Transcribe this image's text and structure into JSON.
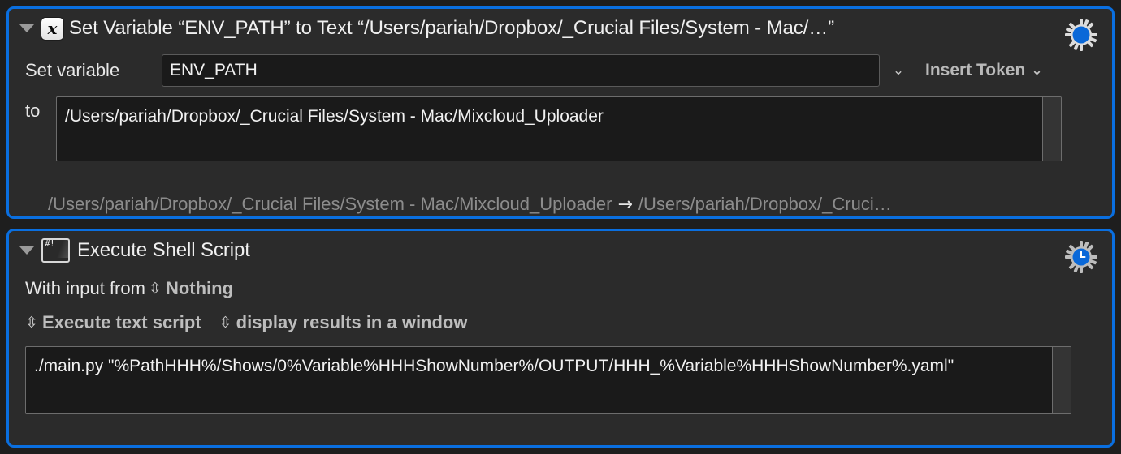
{
  "colors": {
    "selection_border": "#0a6fe0",
    "panel_background": "#2b2b2b",
    "app_background": "#1e1e1e",
    "field_background": "#1a1a1a",
    "text_primary": "#f0f0f0",
    "text_dim": "#8c8c8c"
  },
  "actions": [
    {
      "id": "set-variable",
      "icon": "set-variable-icon",
      "disclosure": "triangle-down-icon",
      "title": "Set Variable “ENV_PATH” to Text “/Users/pariah/Dropbox/_Crucial Files/System - Mac/…”",
      "gear": "gear-icon",
      "fields": {
        "variable_label": "Set variable",
        "variable_value": "ENV_PATH",
        "variable_dropdown_icon": "chevron-down-icon",
        "insert_token_label": "Insert Token",
        "insert_token_icon": "chevron-down-icon",
        "to_label": "to",
        "to_value": "/Users/pariah/Dropbox/_Crucial Files/System - Mac/Mixcloud_Uploader"
      },
      "preview": {
        "left": "/Users/pariah/Dropbox/_Crucial Files/System - Mac/Mixcloud_Uploader",
        "arrow": "→",
        "right": "/Users/pariah/Dropbox/_Cruci…"
      }
    },
    {
      "id": "execute-shell-script",
      "icon": "shell-script-icon",
      "icon_glyph": "#!",
      "disclosure": "triangle-down-icon",
      "title": "Execute Shell Script",
      "gear": "gear-clock-icon",
      "fields": {
        "input_label": "With input from",
        "input_value": "Nothing",
        "input_stepper_icon": "stepper-updown-icon",
        "script_mode_value": "Execute text script",
        "script_mode_stepper_icon": "stepper-updown-icon",
        "results_value": "display results in a window",
        "results_stepper_icon": "stepper-updown-icon",
        "script_text": "./main.py \"%PathHHH%/Shows/0%Variable%HHHShowNumber%/OUTPUT/HHH_%Variable%HHHShowNumber%.yaml\""
      }
    }
  ]
}
